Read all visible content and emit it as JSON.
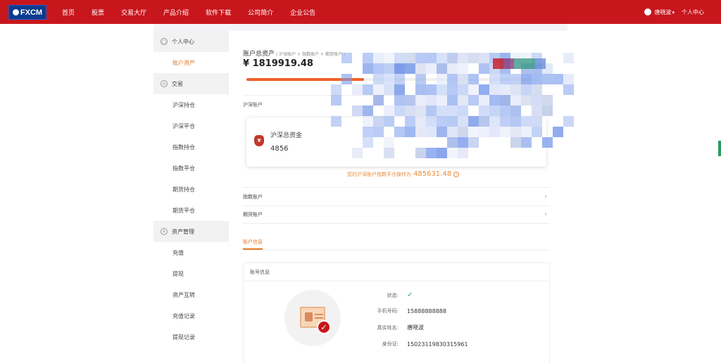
{
  "header": {
    "logo_text": "FXCM",
    "nav": [
      "首页",
      "股票",
      "交易大厅",
      "产品介绍",
      "软件下载",
      "公司简介",
      "企业公告"
    ],
    "user_name": "唐晓波",
    "personal_center": "个人中心"
  },
  "sidebar": {
    "sections": [
      {
        "title": "个人中心",
        "items": [
          "账户资产"
        ]
      },
      {
        "title": "交易",
        "items": [
          "沪深持仓",
          "沪深平仓",
          "指数持仓",
          "指数平仓",
          "期货持仓",
          "期货平仓"
        ]
      },
      {
        "title": "资产管理",
        "items": [
          "充值",
          "提现",
          "资产互转",
          "充值记录",
          "提现记录"
        ]
      }
    ],
    "active_item": "账户资产"
  },
  "main": {
    "total_title": "账户总资产",
    "total_sub": "( 沪深账户 + 指数账户 + 期货账户 )",
    "total_value": "¥ 1819919.48",
    "progress_fraction": 0.39,
    "hushen_label": "沪深账户",
    "card": {
      "label": "沪深总资金",
      "value": "4856"
    },
    "note_text": "您的沪深账户指数平仓操作为",
    "note_value": "485631.48",
    "rows": [
      "指数账户",
      "期货账户"
    ],
    "tab": "账户信息",
    "account_panel": {
      "title": "账号信息",
      "fields": [
        {
          "key": "状态:",
          "value": "✓"
        },
        {
          "key": "手机号码:",
          "value": "15888888888"
        },
        {
          "key": "真实姓名:",
          "value": "唐晓波"
        },
        {
          "key": "身份证:",
          "value": "15023119830315961"
        }
      ]
    }
  },
  "colors": {
    "brand_red": "#c8161d",
    "accent_orange": "#e87722",
    "progress": "#f0622a"
  }
}
